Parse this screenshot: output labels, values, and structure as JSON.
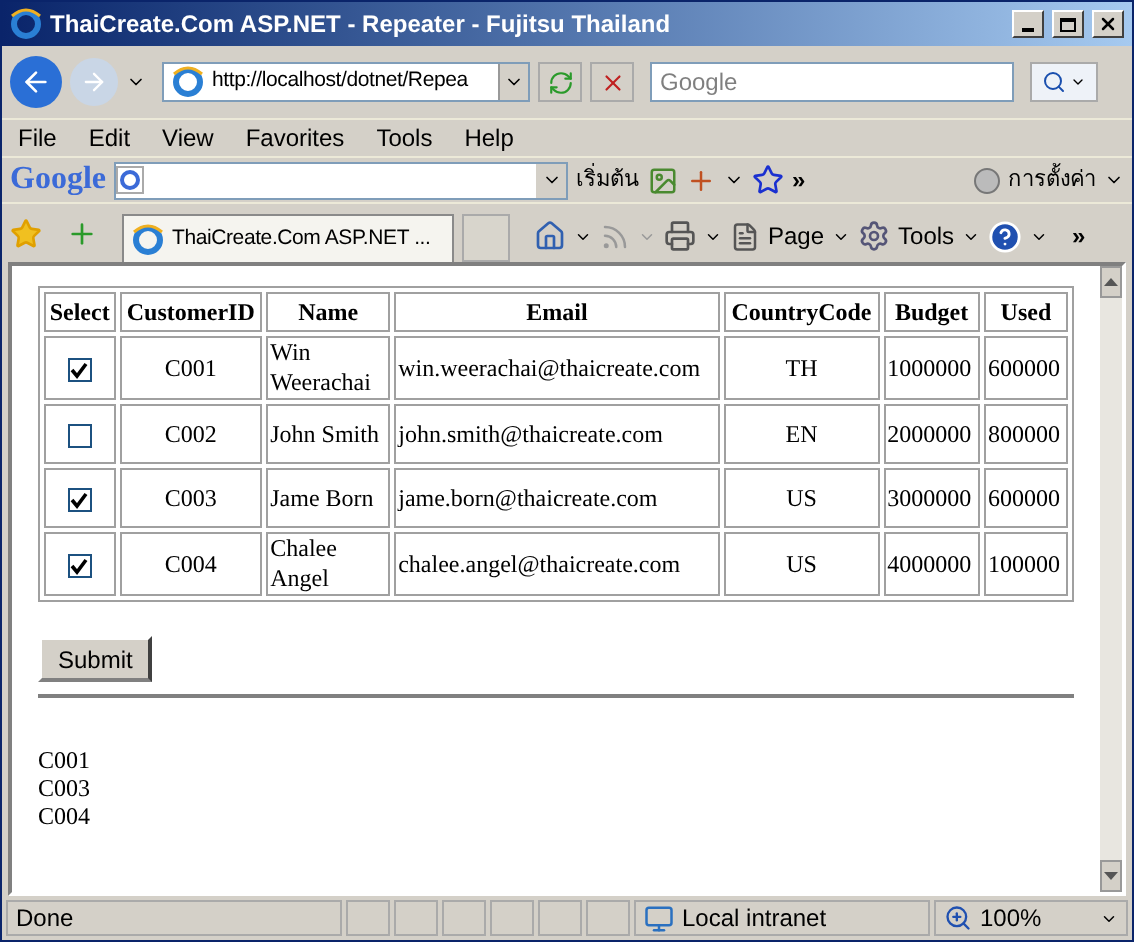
{
  "window": {
    "title": "ThaiCreate.Com ASP.NET - Repeater - Fujitsu Thailand"
  },
  "address": {
    "value": "http://localhost/dotnet/Repea"
  },
  "search": {
    "placeholder": "Google"
  },
  "menu": [
    "File",
    "Edit",
    "View",
    "Favorites",
    "Tools",
    "Help"
  ],
  "google_bar": {
    "logo": "Google",
    "home": "เริ่มต้น",
    "more": "»",
    "settings": "การตั้งค่า"
  },
  "tab": {
    "label": "ThaiCreate.Com ASP.NET ...",
    "selected": true
  },
  "command_bar": {
    "page": "Page",
    "tools": "Tools",
    "more": "»"
  },
  "table": {
    "columns": [
      "Select",
      "CustomerID",
      "Name",
      "Email",
      "CountryCode",
      "Budget",
      "Used"
    ],
    "rows": [
      {
        "checked": true,
        "id": "C001",
        "name": "Win Weerachai",
        "email": "win.weerachai@thaicreate.com",
        "country": "TH",
        "budget": "1000000",
        "used": "600000"
      },
      {
        "checked": false,
        "id": "C002",
        "name": "John Smith",
        "email": "john.smith@thaicreate.com",
        "country": "EN",
        "budget": "2000000",
        "used": "800000"
      },
      {
        "checked": true,
        "id": "C003",
        "name": "Jame Born",
        "email": "jame.born@thaicreate.com",
        "country": "US",
        "budget": "3000000",
        "used": "600000"
      },
      {
        "checked": true,
        "id": "C004",
        "name": "Chalee Angel",
        "email": "chalee.angel@thaicreate.com",
        "country": "US",
        "budget": "4000000",
        "used": "100000"
      }
    ]
  },
  "submit": "Submit",
  "results": [
    "C001",
    "C003",
    "C004"
  ],
  "status_bar": {
    "text": "Done",
    "zone": "Local intranet",
    "zoom": "100%"
  }
}
